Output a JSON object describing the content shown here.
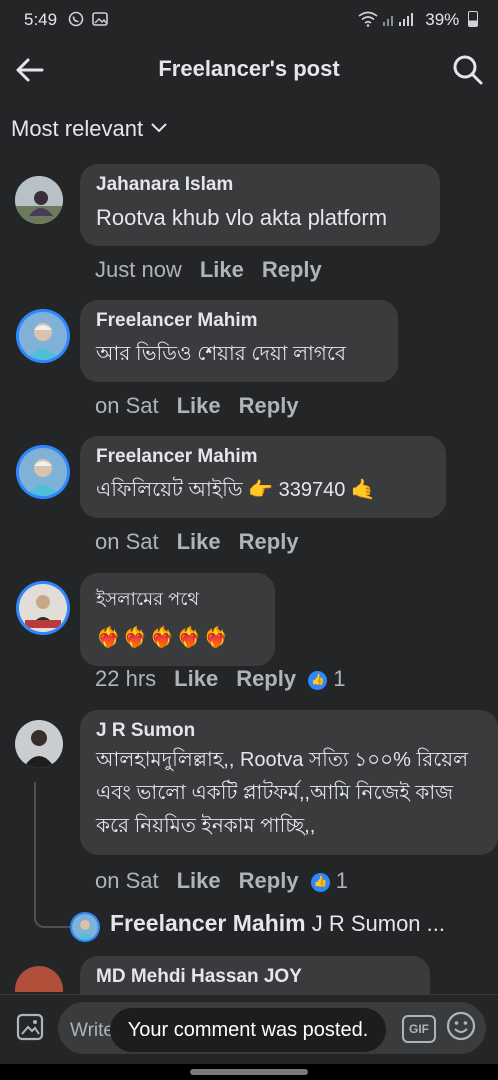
{
  "status_bar": {
    "time": "5:49",
    "battery": "39%",
    "icons": [
      "whatsapp-icon",
      "gallery-icon",
      "wifi-icon",
      "signal-icon",
      "battery-icon"
    ]
  },
  "header": {
    "title": "Freelancer's post",
    "icons": [
      "back-arrow-icon",
      "search-icon"
    ]
  },
  "sort": {
    "label": "Most relevant"
  },
  "comments": [
    {
      "name": "Jahanara Islam",
      "text": "Rootva khub vlo akta platform",
      "time": "Just now",
      "like": "Like",
      "reply": "Reply"
    },
    {
      "name": "Freelancer Mahim",
      "text": "আর ভিডিও শেয়ার দেয়া লাগবে",
      "time": "on Sat",
      "like": "Like",
      "reply": "Reply"
    },
    {
      "name": "Freelancer Mahim",
      "text": "এফিলিয়েট আইডি 👉 339740 🤙",
      "time": "on Sat",
      "like": "Like",
      "reply": "Reply"
    },
    {
      "name": "ইসলামের পথে",
      "text": "❤️‍🔥❤️‍🔥❤️‍🔥❤️‍🔥❤️‍🔥",
      "time": "22 hrs",
      "like": "Like",
      "reply": "Reply",
      "reactions": "1"
    },
    {
      "name": "J R Sumon",
      "text": "আলহামদুলিল্লাহ,, Rootva সত্যি ১০০% রিয়েল এবং ভালো একটি প্লাটফর্ম,,আমি নিজেই কাজ করে নিয়মিত ইনকাম পাচ্ছি,,",
      "time": "on Sat",
      "like": "Like",
      "reply": "Reply",
      "reactions": "1",
      "reply_preview": {
        "name": "Freelancer Mahim",
        "text": "J R Sumon ..."
      }
    },
    {
      "name": "MD Mehdi Hassan JOY"
    }
  ],
  "composer": {
    "placeholder": "Write a comment…",
    "gif_label": "GIF"
  },
  "toast": {
    "text": "Your comment was posted."
  },
  "colors": {
    "background": "#242526",
    "bubble": "#3a3b3c",
    "accent": "#2d88ff",
    "muted": "#b0b3b8"
  }
}
